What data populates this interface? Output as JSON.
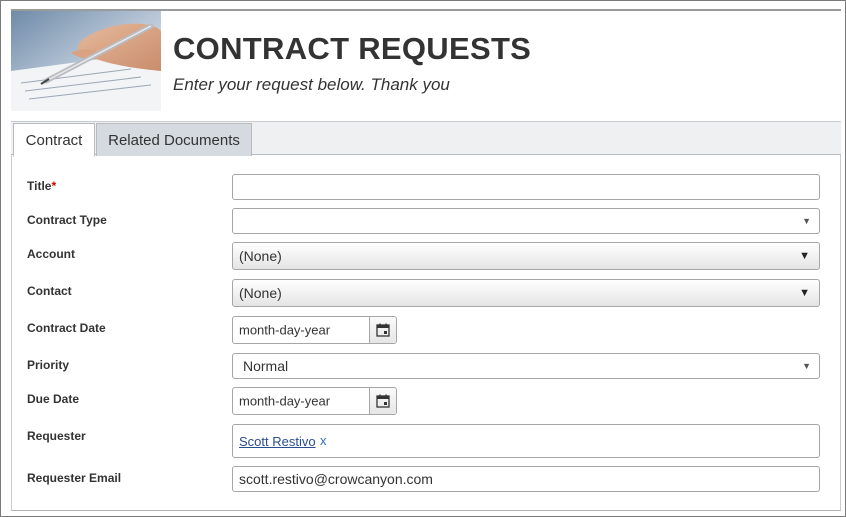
{
  "header": {
    "title": "CONTRACT REQUESTS",
    "subtitle": "Enter your request below. Thank you"
  },
  "tabs": [
    {
      "label": "Contract",
      "active": true
    },
    {
      "label": "Related Documents",
      "active": false
    }
  ],
  "form": {
    "title": {
      "label": "Title",
      "required_mark": "*",
      "value": ""
    },
    "contract_type": {
      "label": "Contract Type",
      "value": ""
    },
    "account": {
      "label": "Account",
      "value": "(None)"
    },
    "contact": {
      "label": "Contact",
      "value": "(None)"
    },
    "contract_date": {
      "label": "Contract Date",
      "placeholder": "month-day-year"
    },
    "priority": {
      "label": "Priority",
      "value": "Normal"
    },
    "due_date": {
      "label": "Due Date",
      "placeholder": "month-day-year"
    },
    "requester": {
      "label": "Requester",
      "value": "Scott Restivo",
      "remove": "x"
    },
    "requester_email": {
      "label": "Requester Email",
      "value": "scott.restivo@crowcanyon.com"
    }
  },
  "colors": {
    "tab_inactive_bg": "#d4dae0",
    "required": "#cc0000",
    "link": "#2a4d8f"
  }
}
